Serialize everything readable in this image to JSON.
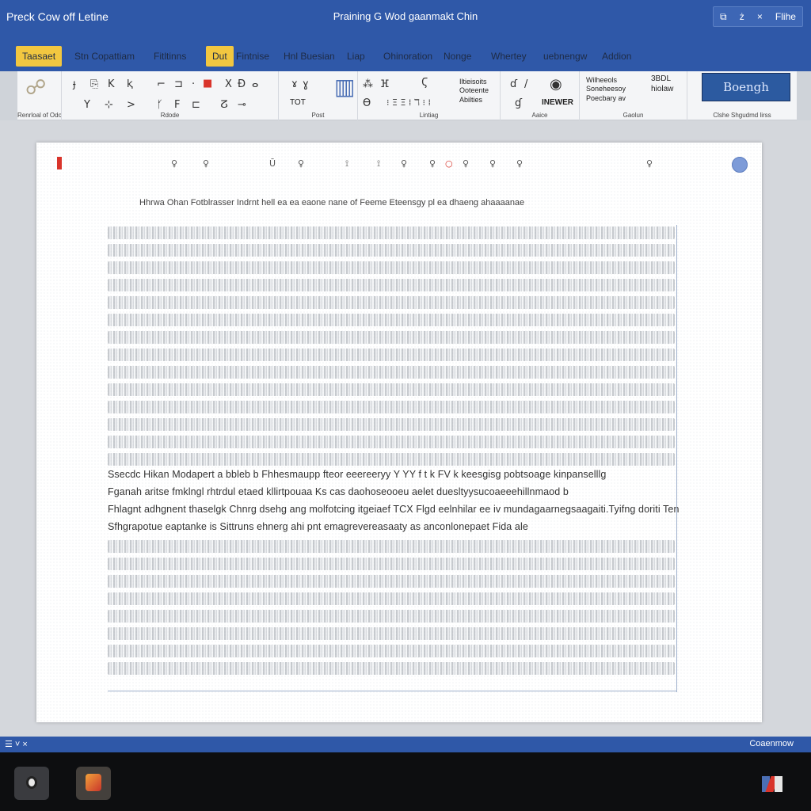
{
  "window": {
    "app_title": "Preck Cow off Letine",
    "doc_title": "Praining G Wod gaanmakt Chin",
    "controls": {
      "restore": "⧉",
      "minimize": "ż",
      "close": "×",
      "label": "Flihe"
    }
  },
  "tabs": [
    {
      "label": "Taasaet",
      "active": true
    },
    {
      "label": "Stn Copattiam",
      "active": false
    },
    {
      "label": "Fitltinns",
      "active": false
    },
    {
      "label": "Dut",
      "active": true
    },
    {
      "label": "Fintnise",
      "active": false
    },
    {
      "label": "Hnl Buesian",
      "active": false
    },
    {
      "label": "Liap",
      "active": false
    },
    {
      "label": "Ohinoration",
      "active": false
    },
    {
      "label": "Nonge",
      "active": false
    },
    {
      "label": "Whertey",
      "active": false
    },
    {
      "label": "uebnengw",
      "active": false
    },
    {
      "label": "Addion",
      "active": false
    }
  ],
  "ribbon": {
    "groups": [
      {
        "label": "Renrloal of Odors"
      },
      {
        "label": "Rdode"
      },
      {
        "label": "Post"
      },
      {
        "label": "Lintiag"
      },
      {
        "label": "Aaice"
      },
      {
        "label": "Gaolun"
      },
      {
        "label": "Clshe Shgudmd lirss"
      }
    ],
    "texts": {
      "t1": "TOT",
      "t2": "Iltieisoits\nOoteente\nAbilties",
      "t3": "INEWER",
      "t4": "Wilheeols\nSoneheesoy\nPoecbary av",
      "t5": "3BDL\nhiolaw",
      "logo": "Boengh"
    }
  },
  "document": {
    "header": "Hhrwa Ohan  Fotblrasser Indrnt hell ea  ea eaone     nane  of  Feeme Eteensgy pl ea  dhaeng ahaaaanae",
    "paragraph": [
      "Ssecdc Hikan Modapert a bbleb b Fhhesmaupp fteor eeereeryy Y YY f t k FV  k keesgisg  pobtsoage kinpanselllg",
      "Fganah aritse fmklngl rhtrdul etaed kllirtpouaa Ks  cas  daohoseooeu aelet duesltyysucoaeeehillnmaod  b",
      "Fhlagnt adhgnent thaselgk Chnrg dsehg  ang molfotcing itgeiaef TCX Flgd  eelnhilar ee  iv mundagaarnegsaagaiti.Tyifng doriti Ten",
      "Sfhgrapotue eaptanke is Sittruns ehnerg ahi pnt  emagrevereasaaty as anconlonepaet Fida  ale"
    ]
  },
  "status": {
    "left": "☰  ˅  ×",
    "right": "Coaenmow"
  }
}
